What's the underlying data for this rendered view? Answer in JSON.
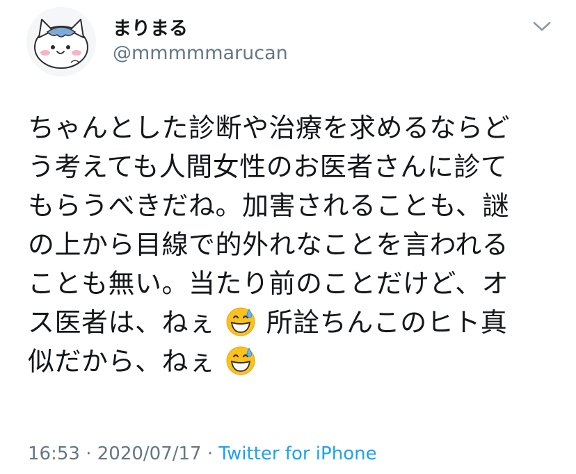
{
  "user": {
    "display_name": "まりまる",
    "handle": "@mmmmmarucan",
    "avatar_icon": "cat-avatar-icon"
  },
  "tweet": {
    "lines": [
      "ちゃんとした診断や治療を求めるならど",
      "う考えても人間女性のお医者さんに診て",
      "もらうべきだね。加害されることも、謎",
      "の上から目線で的外れなことを言われる",
      "ことも無い。当たり前のことだけど、オ"
    ],
    "line6_before": "ス医者は、ねぇ",
    "line6_after": "所詮ちんこのヒト真",
    "line7_before": "似だから、ねぇ",
    "emoji_icon": "grinning-sweat-emoji-icon"
  },
  "meta": {
    "time": "16:53",
    "separator": "·",
    "date": "2020/07/17",
    "source": "Twitter for iPhone"
  },
  "colors": {
    "text": "#14171a",
    "secondary": "#657786",
    "link": "#1da1f2"
  }
}
